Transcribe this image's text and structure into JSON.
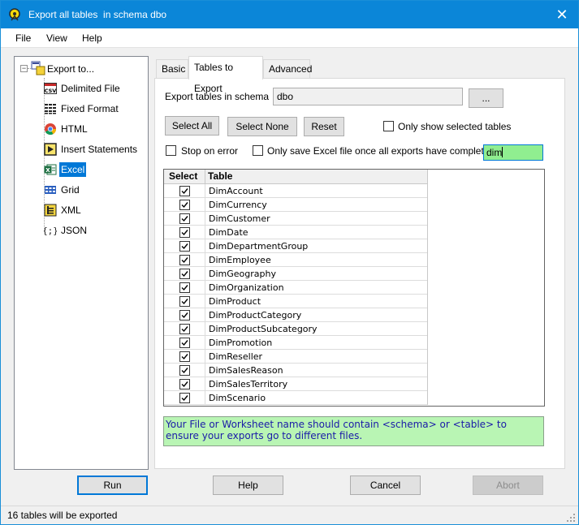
{
  "window": {
    "title": "Export all tables  in schema dbo",
    "close_glyph": "✕",
    "title_color": "#0b86d8"
  },
  "menu": [
    {
      "label": "File"
    },
    {
      "label": "View"
    },
    {
      "label": "Help"
    }
  ],
  "tree": {
    "expander_glyph": "−",
    "root_label": "Export to...",
    "items": [
      {
        "label": "Delimited File",
        "icon": "csv-file-icon"
      },
      {
        "label": "Fixed Format",
        "icon": "fixed-format-icon"
      },
      {
        "label": "HTML",
        "icon": "chrome-browser-icon"
      },
      {
        "label": "Insert Statements",
        "icon": "insert-statements-icon"
      },
      {
        "label": "Excel",
        "icon": "excel-icon",
        "selected": true
      },
      {
        "label": "Grid",
        "icon": "grid-icon"
      },
      {
        "label": "XML",
        "icon": "xml-icon"
      },
      {
        "label": "JSON",
        "icon": "json-icon"
      }
    ]
  },
  "tabs": [
    {
      "label": "Basic"
    },
    {
      "label": "Tables to Export",
      "active": true
    },
    {
      "label": "Advanced"
    }
  ],
  "export_panel": {
    "schema_label": "Export tables in schema",
    "schema_value": "dbo",
    "browse_label": "...",
    "select_all_label": "Select All",
    "select_none_label": "Select None",
    "reset_label": "Reset",
    "only_selected_label": "Only show selected tables",
    "only_selected_checked": false,
    "stop_on_error_label": "Stop on error",
    "stop_on_error_checked": false,
    "save_once_label": "Only save Excel file once all exports have completed",
    "save_once_checked": false,
    "filter_value": "dim"
  },
  "table_grid": {
    "col_select": "Select",
    "col_table": "Table",
    "rows": [
      {
        "name": "DimAccount",
        "checked": true
      },
      {
        "name": "DimCurrency",
        "checked": true
      },
      {
        "name": "DimCustomer",
        "checked": true
      },
      {
        "name": "DimDate",
        "checked": true
      },
      {
        "name": "DimDepartmentGroup",
        "checked": true
      },
      {
        "name": "DimEmployee",
        "checked": true
      },
      {
        "name": "DimGeography",
        "checked": true
      },
      {
        "name": "DimOrganization",
        "checked": true
      },
      {
        "name": "DimProduct",
        "checked": true
      },
      {
        "name": "DimProductCategory",
        "checked": true
      },
      {
        "name": "DimProductSubcategory",
        "checked": true
      },
      {
        "name": "DimPromotion",
        "checked": true
      },
      {
        "name": "DimReseller",
        "checked": true
      },
      {
        "name": "DimSalesReason",
        "checked": true
      },
      {
        "name": "DimSalesTerritory",
        "checked": true
      },
      {
        "name": "DimScenario",
        "checked": true
      }
    ]
  },
  "hint": {
    "text": "Your File or Worksheet name should contain <schema> or <table> to ensure your exports go to different files.",
    "background": "#b9f5b4",
    "color": "#1a1aa8"
  },
  "buttons": {
    "run": "Run",
    "help": "Help",
    "cancel": "Cancel",
    "abort": "Abort"
  },
  "status": {
    "text": "16 tables will be exported"
  }
}
